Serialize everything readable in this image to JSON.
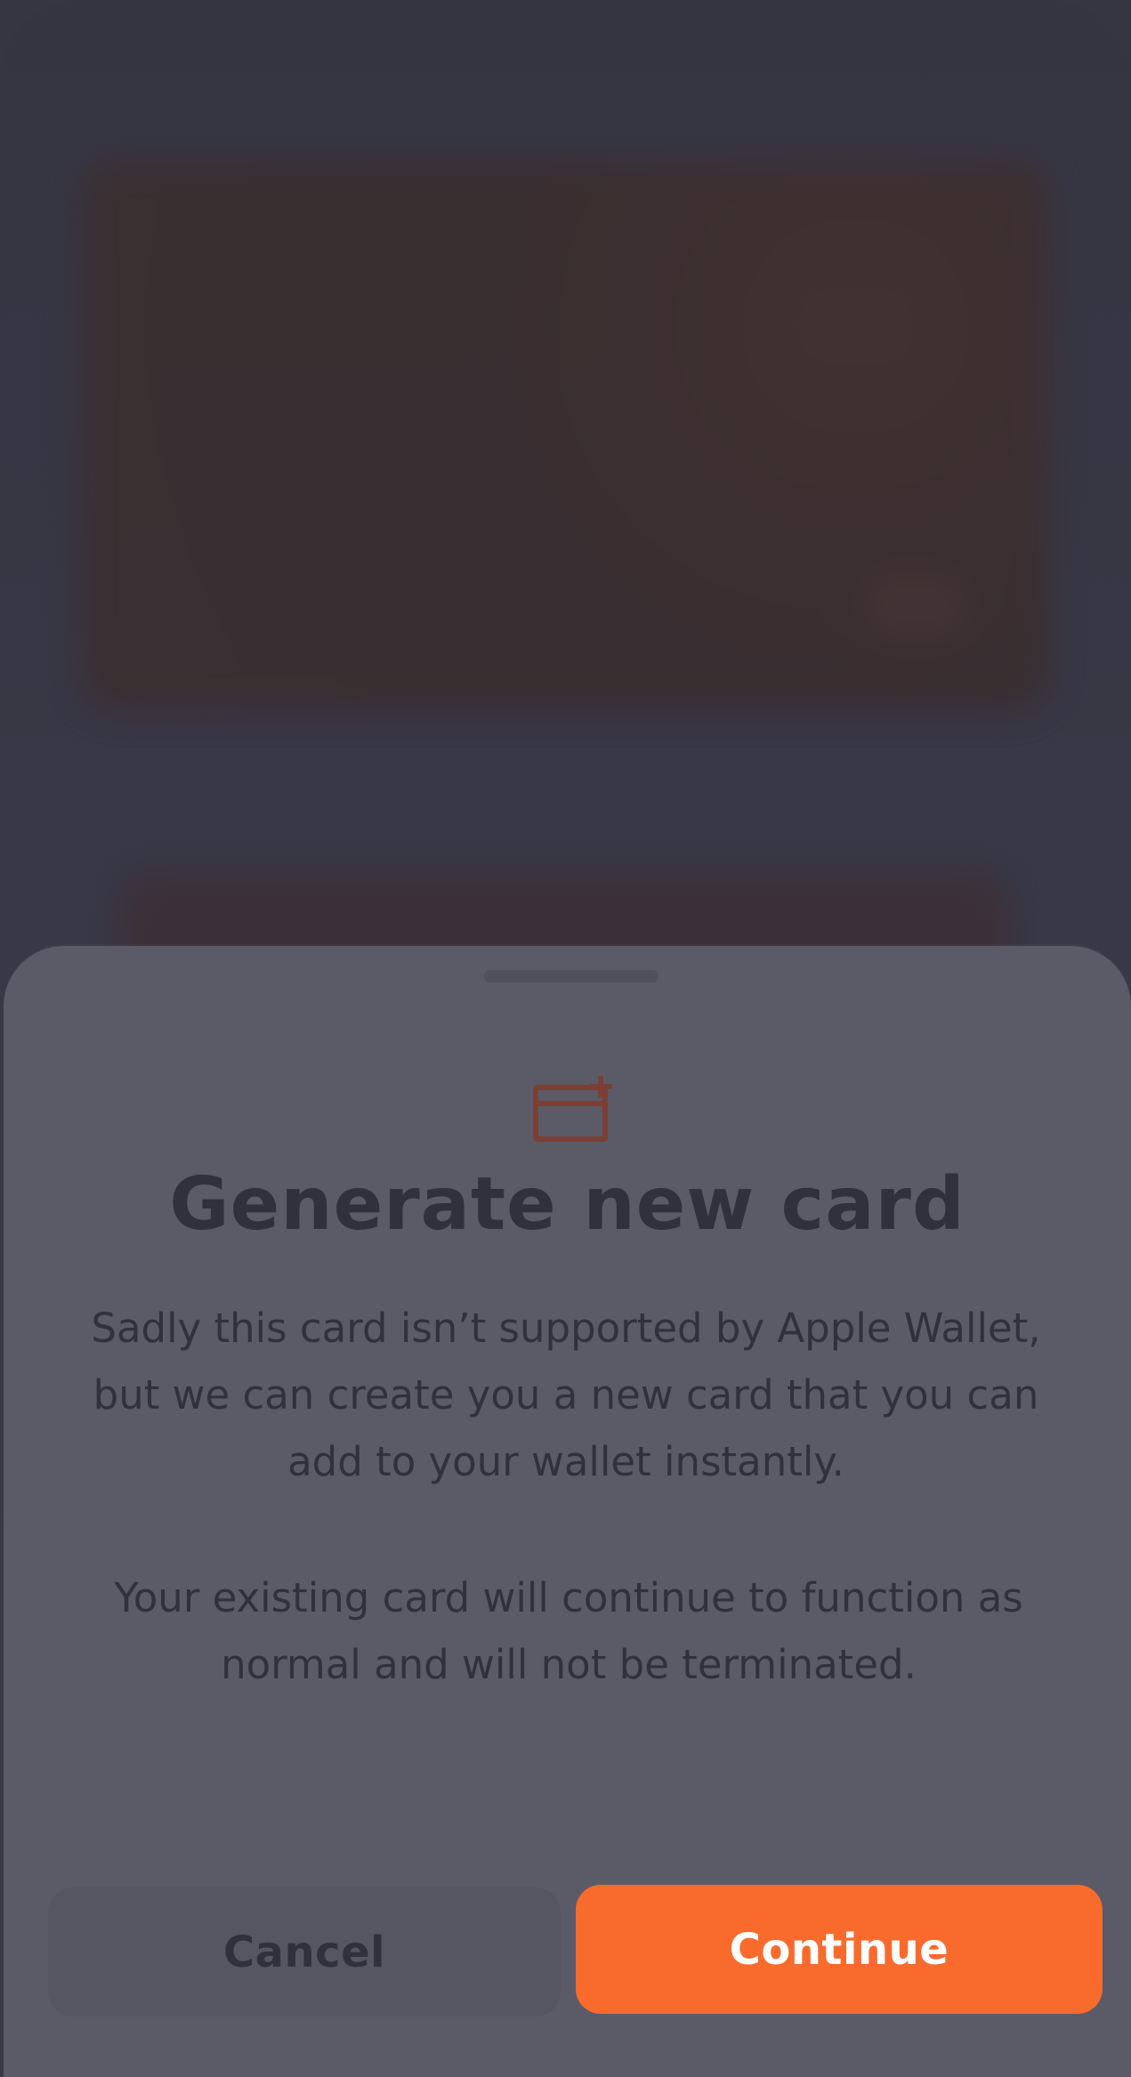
{
  "modal": {
    "title": "Generate new card",
    "message_1": "Sadly this card isn’t supported by Apple Wallet, but we can create you a new card that you can add to your wallet instantly.",
    "message_2": "Your existing card will continue to function as normal and will not be terminated.",
    "cancel_label": "Cancel",
    "continue_label": "Continue",
    "icon": "new-card-plus-icon"
  },
  "colors": {
    "background": "#363642",
    "sheet": "#5b5b67",
    "text_dark": "#31313d",
    "accent": "#f96b2c",
    "icon_accent": "#7b3f35"
  }
}
